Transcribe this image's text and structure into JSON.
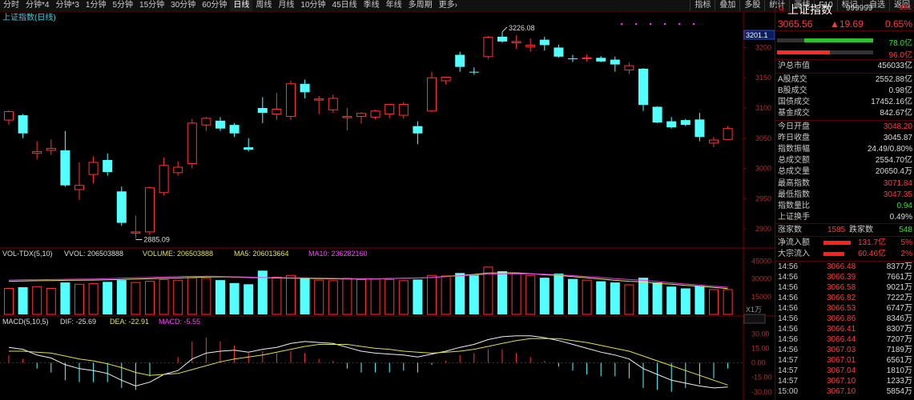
{
  "toolbar": {
    "timeframes": [
      {
        "label": "分时",
        "active": false
      },
      {
        "label": "分钟*4",
        "active": false
      },
      {
        "label": "分钟*3",
        "active": false
      },
      {
        "label": "1分钟",
        "active": false
      },
      {
        "label": "5分钟",
        "active": false
      },
      {
        "label": "15分钟",
        "active": false
      },
      {
        "label": "30分钟",
        "active": false
      },
      {
        "label": "60分钟",
        "active": false
      },
      {
        "label": "日线",
        "active": true
      },
      {
        "label": "周线",
        "active": false
      },
      {
        "label": "月线",
        "active": false
      },
      {
        "label": "10分钟",
        "active": false
      },
      {
        "label": "45日线",
        "active": false
      },
      {
        "label": "季线",
        "active": false
      },
      {
        "label": "年线",
        "active": false
      },
      {
        "label": "多周期",
        "active": false
      },
      {
        "label": "更多›",
        "active": false
      }
    ],
    "tools": [
      "指标",
      "叠加",
      "多股",
      "统计",
      "画线",
      "F10",
      "标记",
      "-自选",
      "返回"
    ]
  },
  "main_chart": {
    "title": "上证指数(日线)",
    "price_axis": [
      "3200",
      "3150",
      "3100",
      "3050",
      "3000",
      "2950",
      "2900"
    ],
    "price_tag": "3201.1",
    "high_label": "3226.08",
    "low_label": "2885.09"
  },
  "volume_panel": {
    "label": "VOL-TDX(5,10)",
    "vvol": "VVOL: 206503888",
    "volume": "VOLUME: 206503888",
    "ma5": "MA5: 206013664",
    "ma10": "MA10: 236282160",
    "axis": [
      "45000",
      "30000",
      "15000"
    ],
    "unit": "X1万"
  },
  "macd_panel": {
    "label": "MACD(5,10,5)",
    "dif": "DIF: -25.69",
    "dea": "DEA: -22.91",
    "macd": "MACD: -5.55",
    "axis": [
      "30.00",
      "15.00",
      "0.00",
      "-15.00",
      "-30.00"
    ]
  },
  "chart_data": {
    "type": "candlestick",
    "title": "上证指数(日线)",
    "ylim": [
      2875,
      3235
    ],
    "grid": false,
    "candles": [
      {
        "o": 3080,
        "h": 3096,
        "l": 3072,
        "c": 3094
      },
      {
        "o": 3088,
        "h": 3090,
        "l": 3050,
        "c": 3058
      },
      {
        "o": 3025,
        "h": 3045,
        "l": 3015,
        "c": 3028
      },
      {
        "o": 3030,
        "h": 3048,
        "l": 3022,
        "c": 3033
      },
      {
        "o": 3030,
        "h": 3062,
        "l": 2970,
        "c": 2972
      },
      {
        "o": 2965,
        "h": 3010,
        "l": 2948,
        "c": 2972
      },
      {
        "o": 2990,
        "h": 3020,
        "l": 2975,
        "c": 3010
      },
      {
        "o": 3014,
        "h": 3025,
        "l": 2988,
        "c": 2994
      },
      {
        "o": 2962,
        "h": 2970,
        "l": 2905,
        "c": 2910
      },
      {
        "o": 2893,
        "h": 2922,
        "l": 2885,
        "c": 2895
      },
      {
        "o": 2895,
        "h": 2970,
        "l": 2890,
        "c": 2968
      },
      {
        "o": 2960,
        "h": 3018,
        "l": 2955,
        "c": 3005
      },
      {
        "o": 2993,
        "h": 3012,
        "l": 2988,
        "c": 3002
      },
      {
        "o": 3008,
        "h": 3082,
        "l": 3000,
        "c": 3075
      },
      {
        "o": 3072,
        "h": 3085,
        "l": 3062,
        "c": 3083
      },
      {
        "o": 3079,
        "h": 3085,
        "l": 3062,
        "c": 3066
      },
      {
        "o": 3072,
        "h": 3075,
        "l": 3052,
        "c": 3058
      },
      {
        "o": 3035,
        "h": 3050,
        "l": 3028,
        "c": 3031
      },
      {
        "o": 3100,
        "h": 3118,
        "l": 3075,
        "c": 3092
      },
      {
        "o": 3090,
        "h": 3125,
        "l": 3080,
        "c": 3098
      },
      {
        "o": 3086,
        "h": 3145,
        "l": 3080,
        "c": 3140
      },
      {
        "o": 3140,
        "h": 3147,
        "l": 3116,
        "c": 3126
      },
      {
        "o": 3113,
        "h": 3120,
        "l": 3090,
        "c": 3115
      },
      {
        "o": 3097,
        "h": 3122,
        "l": 3092,
        "c": 3116
      },
      {
        "o": 3084,
        "h": 3100,
        "l": 3063,
        "c": 3086
      },
      {
        "o": 3086,
        "h": 3093,
        "l": 3074,
        "c": 3091
      },
      {
        "o": 3085,
        "h": 3097,
        "l": 3081,
        "c": 3095
      },
      {
        "o": 3090,
        "h": 3106,
        "l": 3083,
        "c": 3106
      },
      {
        "o": 3088,
        "h": 3110,
        "l": 3082,
        "c": 3106
      },
      {
        "o": 3070,
        "h": 3078,
        "l": 3040,
        "c": 3058
      },
      {
        "o": 3095,
        "h": 3160,
        "l": 3093,
        "c": 3150
      },
      {
        "o": 3145,
        "h": 3152,
        "l": 3139,
        "c": 3151
      },
      {
        "o": 3188,
        "h": 3193,
        "l": 3160,
        "c": 3168
      },
      {
        "o": 3160,
        "h": 3167,
        "l": 3155,
        "c": 3159
      },
      {
        "o": 3185,
        "h": 3219,
        "l": 3181,
        "c": 3217
      },
      {
        "o": 3218,
        "h": 3226,
        "l": 3208,
        "c": 3210
      },
      {
        "o": 3208,
        "h": 3220,
        "l": 3198,
        "c": 3210
      },
      {
        "o": 3201,
        "h": 3215,
        "l": 3193,
        "c": 3204
      },
      {
        "o": 3213,
        "h": 3218,
        "l": 3195,
        "c": 3204
      },
      {
        "o": 3200,
        "h": 3205,
        "l": 3183,
        "c": 3185
      },
      {
        "o": 3182,
        "h": 3188,
        "l": 3176,
        "c": 3181
      },
      {
        "o": 3182,
        "h": 3189,
        "l": 3177,
        "c": 3183
      },
      {
        "o": 3183,
        "h": 3186,
        "l": 3176,
        "c": 3177
      },
      {
        "o": 3180,
        "h": 3185,
        "l": 3160,
        "c": 3172
      },
      {
        "o": 3163,
        "h": 3175,
        "l": 3156,
        "c": 3170
      },
      {
        "o": 3165,
        "h": 3166,
        "l": 3095,
        "c": 3105
      },
      {
        "o": 3102,
        "h": 3103,
        "l": 3075,
        "c": 3076
      },
      {
        "o": 3078,
        "h": 3085,
        "l": 3066,
        "c": 3068
      },
      {
        "o": 3080,
        "h": 3082,
        "l": 3070,
        "c": 3072
      },
      {
        "o": 3081,
        "h": 3092,
        "l": 3045,
        "c": 3052
      },
      {
        "o": 3042,
        "h": 3052,
        "l": 3035,
        "c": 3047
      },
      {
        "o": 3048,
        "h": 3070,
        "l": 3047,
        "c": 3066
      }
    ],
    "volume": [
      22000,
      23000,
      23500,
      22000,
      27000,
      25500,
      26000,
      27500,
      29000,
      27000,
      28000,
      29500,
      29000,
      31000,
      30500,
      29000,
      26500,
      25500,
      37000,
      31500,
      33000,
      30500,
      29000,
      28500,
      30500,
      29500,
      30000,
      29500,
      28500,
      29500,
      33000,
      32500,
      35000,
      33000,
      40000,
      36500,
      35000,
      33000,
      31000,
      34500,
      30000,
      29000,
      28000,
      27000,
      25000,
      31000,
      27000,
      23500,
      22000,
      24000,
      21000,
      21000
    ],
    "volume_ma5": [
      28000,
      28200,
      28500,
      28600,
      28800,
      28900,
      29000,
      29200,
      29500,
      29800,
      30200,
      30500,
      30800,
      31200,
      31600,
      31800,
      31500,
      31200,
      31000,
      30800,
      30600,
      30500,
      30300,
      30100,
      30000,
      29900,
      30000,
      30400,
      30600,
      30800,
      31200,
      32100,
      33000,
      33800,
      35000,
      35200,
      35100,
      34500,
      33500,
      33000,
      32000,
      31000,
      30000,
      28800,
      28000,
      27500,
      26200,
      25500,
      24500,
      23800,
      22800,
      21800
    ],
    "volume_ma10": [
      29000,
      29200,
      29300,
      29500,
      29700,
      29800,
      30000,
      30300,
      30600,
      30900,
      31200,
      31600,
      31900,
      32200,
      32300,
      32100,
      31800,
      31500,
      31200,
      31100,
      31000,
      30900,
      30700,
      30500,
      30300,
      30200,
      30200,
      30300,
      30500,
      30800,
      31300,
      32000,
      32700,
      33300,
      34000,
      34300,
      34400,
      34300,
      34000,
      33500,
      32800,
      32000,
      31200,
      30300,
      29500,
      28800,
      27800,
      26700,
      25700,
      24800,
      23800,
      22900
    ],
    "macd_dif": [
      16,
      14,
      8,
      5,
      -2,
      -6,
      -8,
      -11,
      -18,
      -24,
      -20,
      -12,
      -8,
      4,
      10,
      12,
      13,
      11,
      14,
      16,
      20,
      22,
      21,
      20,
      16,
      12,
      10,
      9,
      8,
      6,
      9,
      12,
      16,
      19,
      24,
      27,
      28,
      28,
      26,
      23,
      19,
      15,
      11,
      8,
      4,
      -6,
      -12,
      -18,
      -21,
      -24,
      -26,
      -25
    ],
    "macd_dea": [
      12,
      12,
      11,
      10,
      7,
      4,
      2,
      -1,
      -5,
      -10,
      -13,
      -12,
      -11,
      -7,
      -3,
      1,
      4,
      6,
      8,
      11,
      14,
      17,
      19,
      19,
      19,
      17,
      15,
      14,
      12,
      11,
      10,
      11,
      12,
      14,
      17,
      20,
      23,
      25,
      25,
      25,
      23,
      21,
      18,
      15,
      12,
      7,
      2,
      -3,
      -8,
      -13,
      -18,
      -23
    ],
    "macd_hist": [
      8,
      4,
      -6,
      -10,
      -18,
      -20,
      -20,
      -20,
      -26,
      -28,
      -14,
      0,
      6,
      22,
      26,
      22,
      18,
      10,
      12,
      10,
      12,
      10,
      4,
      2,
      -6,
      -10,
      -10,
      -10,
      -8,
      -10,
      -2,
      2,
      8,
      10,
      14,
      14,
      10,
      6,
      2,
      -4,
      -8,
      -12,
      -14,
      -14,
      -16,
      -26,
      -28,
      -30,
      -26,
      -22,
      -16,
      -6
    ]
  },
  "sidebar": {
    "g_label": "G",
    "name": "上证指数",
    "code": "999999",
    "badge": "$G1",
    "price": "3065.56",
    "change": "▲19.69",
    "change_pct": "0.65%",
    "ratio1": "78.0亿",
    "ratio2": "96.0亿",
    "ratio1_fill": 0.72,
    "ratio2_fill": 0.55,
    "market_value_label": "沪总市值",
    "market_value": "456033亿",
    "turnover": [
      {
        "k": "A股成交",
        "v": "2552.88亿"
      },
      {
        "k": "B股成交",
        "v": "0.98亿"
      },
      {
        "k": "国债成交",
        "v": "17452.16亿"
      },
      {
        "k": "基金成交",
        "v": "842.67亿"
      }
    ],
    "stats": [
      {
        "k": "今日开盘",
        "v": "3048.20",
        "c": "red"
      },
      {
        "k": "昨日收盘",
        "v": "3045.87",
        "c": ""
      },
      {
        "k": "指数振幅",
        "v": "24.49/0.80%",
        "c": ""
      },
      {
        "k": "总成交额",
        "v": "2554.70亿",
        "c": ""
      },
      {
        "k": "总成交量",
        "v": "20650.4万",
        "c": ""
      },
      {
        "k": "最高指数",
        "v": "3071.84",
        "c": "red"
      },
      {
        "k": "最低指数",
        "v": "3047.35",
        "c": "red"
      },
      {
        "k": "指数量比",
        "v": "0.94",
        "c": "grn"
      },
      {
        "k": "上证换手",
        "v": "0.49%",
        "c": ""
      }
    ],
    "breadth": {
      "up_label": "涨家数",
      "up": "1585",
      "down_label": "跌家数",
      "down": "548"
    },
    "flows": [
      {
        "k": "净流入额",
        "v1": "131.7亿",
        "v2": "5%"
      },
      {
        "k": "大宗流入",
        "v1": "60.46亿",
        "v2": "2%"
      }
    ],
    "ticks": [
      {
        "t": "14:56",
        "p": "3066.48",
        "q": "8377万"
      },
      {
        "t": "14:56",
        "p": "3066.39",
        "q": "7661万"
      },
      {
        "t": "14:56",
        "p": "3066.58",
        "q": "9021万"
      },
      {
        "t": "14:56",
        "p": "3066.82",
        "q": "7222万"
      },
      {
        "t": "14:56",
        "p": "3066.53",
        "q": "6747万"
      },
      {
        "t": "14:56",
        "p": "3066.86",
        "q": "8346万"
      },
      {
        "t": "14:56",
        "p": "3066.41",
        "q": "8307万"
      },
      {
        "t": "14:56",
        "p": "3066.44",
        "q": "7207万"
      },
      {
        "t": "14:56",
        "p": "3067.03",
        "q": "7189万"
      },
      {
        "t": "14:57",
        "p": "3067.01",
        "q": "6561万"
      },
      {
        "t": "14:57",
        "p": "3067.04",
        "q": "1810万"
      },
      {
        "t": "14:57",
        "p": "3067.10",
        "q": "1233万"
      },
      {
        "t": "15:00",
        "p": "3067.10",
        "q": "5854万"
      }
    ]
  }
}
